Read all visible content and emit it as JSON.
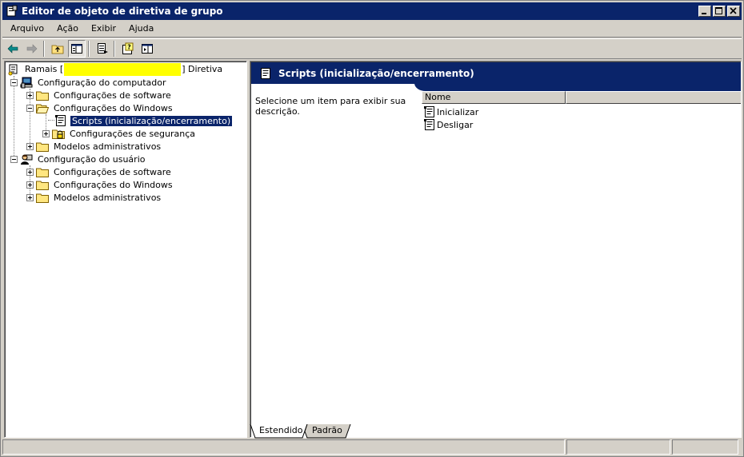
{
  "window": {
    "title": "Editor de objeto de diretiva de grupo",
    "controls": [
      "minimize",
      "maximize",
      "close"
    ]
  },
  "menu": [
    {
      "label": "Arquivo",
      "accel": "A"
    },
    {
      "label": "Ação",
      "accel": "ç"
    },
    {
      "label": "Exibir",
      "accel": "E"
    },
    {
      "label": "Ajuda",
      "accel": "j"
    }
  ],
  "toolbar": {
    "icons": [
      "back-arrow-icon",
      "forward-arrow-icon",
      "up-folder-icon",
      "show-hide-tree-icon",
      "export-list-icon",
      "help-icon",
      "properties-icon"
    ]
  },
  "tree": {
    "root_prefix": "Ramais [",
    "root_suffix": "] Diretiva",
    "items": [
      {
        "label": "Configuração do computador"
      },
      {
        "label": "Configurações de software"
      },
      {
        "label": "Configurações do Windows"
      },
      {
        "label": "Scripts (inicialização/encerramento)",
        "selected": true
      },
      {
        "label": "Configurações de segurança"
      },
      {
        "label": "Modelos administrativos"
      },
      {
        "label": "Configuração do usuário"
      },
      {
        "label": "Configurações de software"
      },
      {
        "label": "Configurações do Windows"
      },
      {
        "label": "Modelos administrativos"
      }
    ]
  },
  "details": {
    "header": "Scripts (inicialização/encerramento)",
    "description": "Selecione um item para exibir sua descrição.",
    "column_name": "Nome",
    "rows": [
      "Inicializar",
      "Desligar"
    ]
  },
  "tabs": [
    {
      "label": "Estendido",
      "active": true
    },
    {
      "label": "Padrão",
      "active": false
    }
  ],
  "colors": {
    "titlebar": "#0a246a",
    "selection": "#0a246a",
    "redaction": "#ffff00",
    "face": "#d4d0c8"
  }
}
